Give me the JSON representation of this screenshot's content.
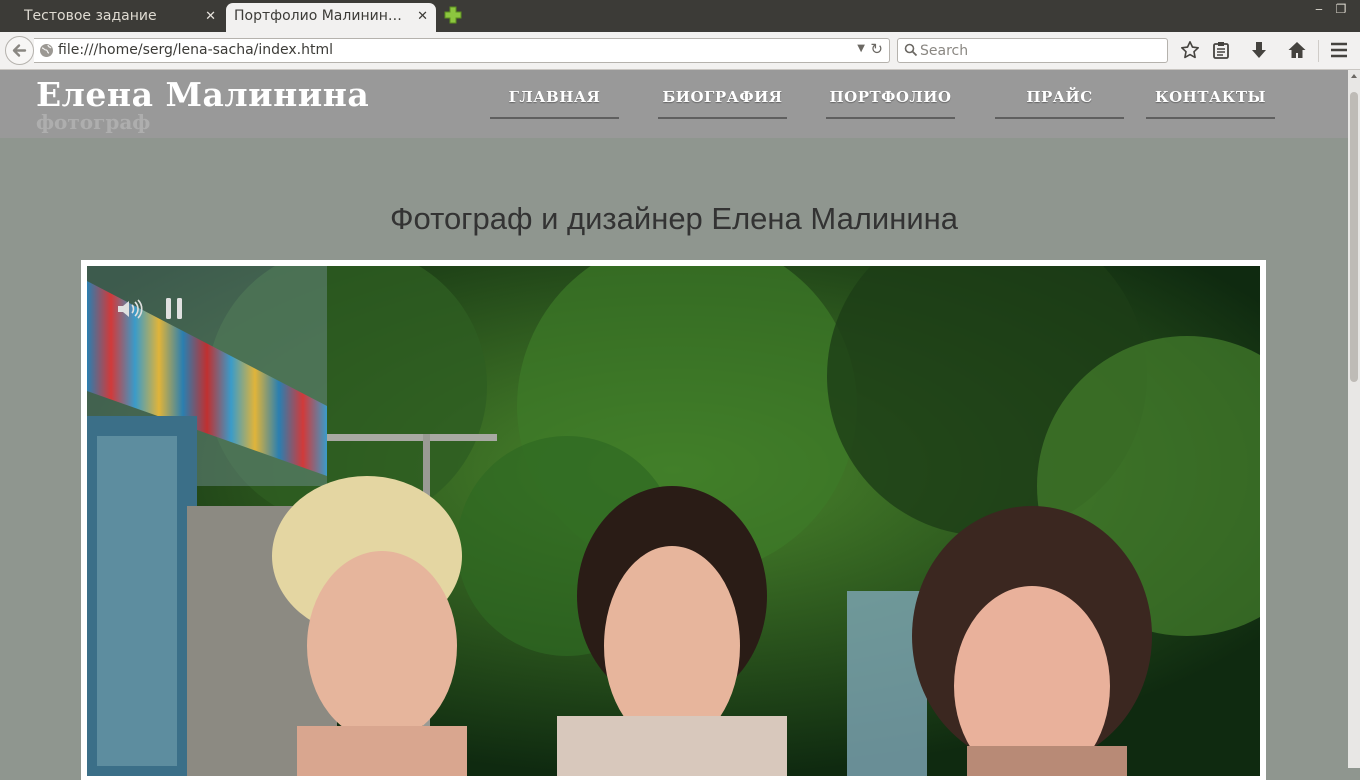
{
  "browser": {
    "tabs": [
      {
        "label": "Тестовое задание",
        "active": false
      },
      {
        "label": "Портфолио Малинин…",
        "active": true
      }
    ],
    "url": "file:///home/serg/lena-sacha/index.html",
    "search_placeholder": "Search",
    "icons": {
      "back": "back-arrow-icon",
      "site": "globe-icon",
      "bookmark": "star-icon",
      "reading_list": "clipboard-icon",
      "downloads": "download-arrow-icon",
      "home": "home-icon",
      "menu": "hamburger-menu-icon"
    }
  },
  "site": {
    "title": "Елена Малинина",
    "subtitle": "фотограф",
    "nav": [
      "ГЛАВНАЯ",
      "БИОГРАФИЯ",
      "ПОРТФОЛИО",
      "ПРАЙС",
      "КОНТАКТЫ"
    ],
    "heading": "Фотограф и дизайнер Елена Малинина",
    "colors": {
      "header_bg": "#999999",
      "page_bg": "#8f968f",
      "nav_underline": "#5f5f5f",
      "tabbar_bg": "#3c3b37"
    },
    "slideshow_controls": [
      "speaker-icon",
      "pause-icon"
    ]
  }
}
